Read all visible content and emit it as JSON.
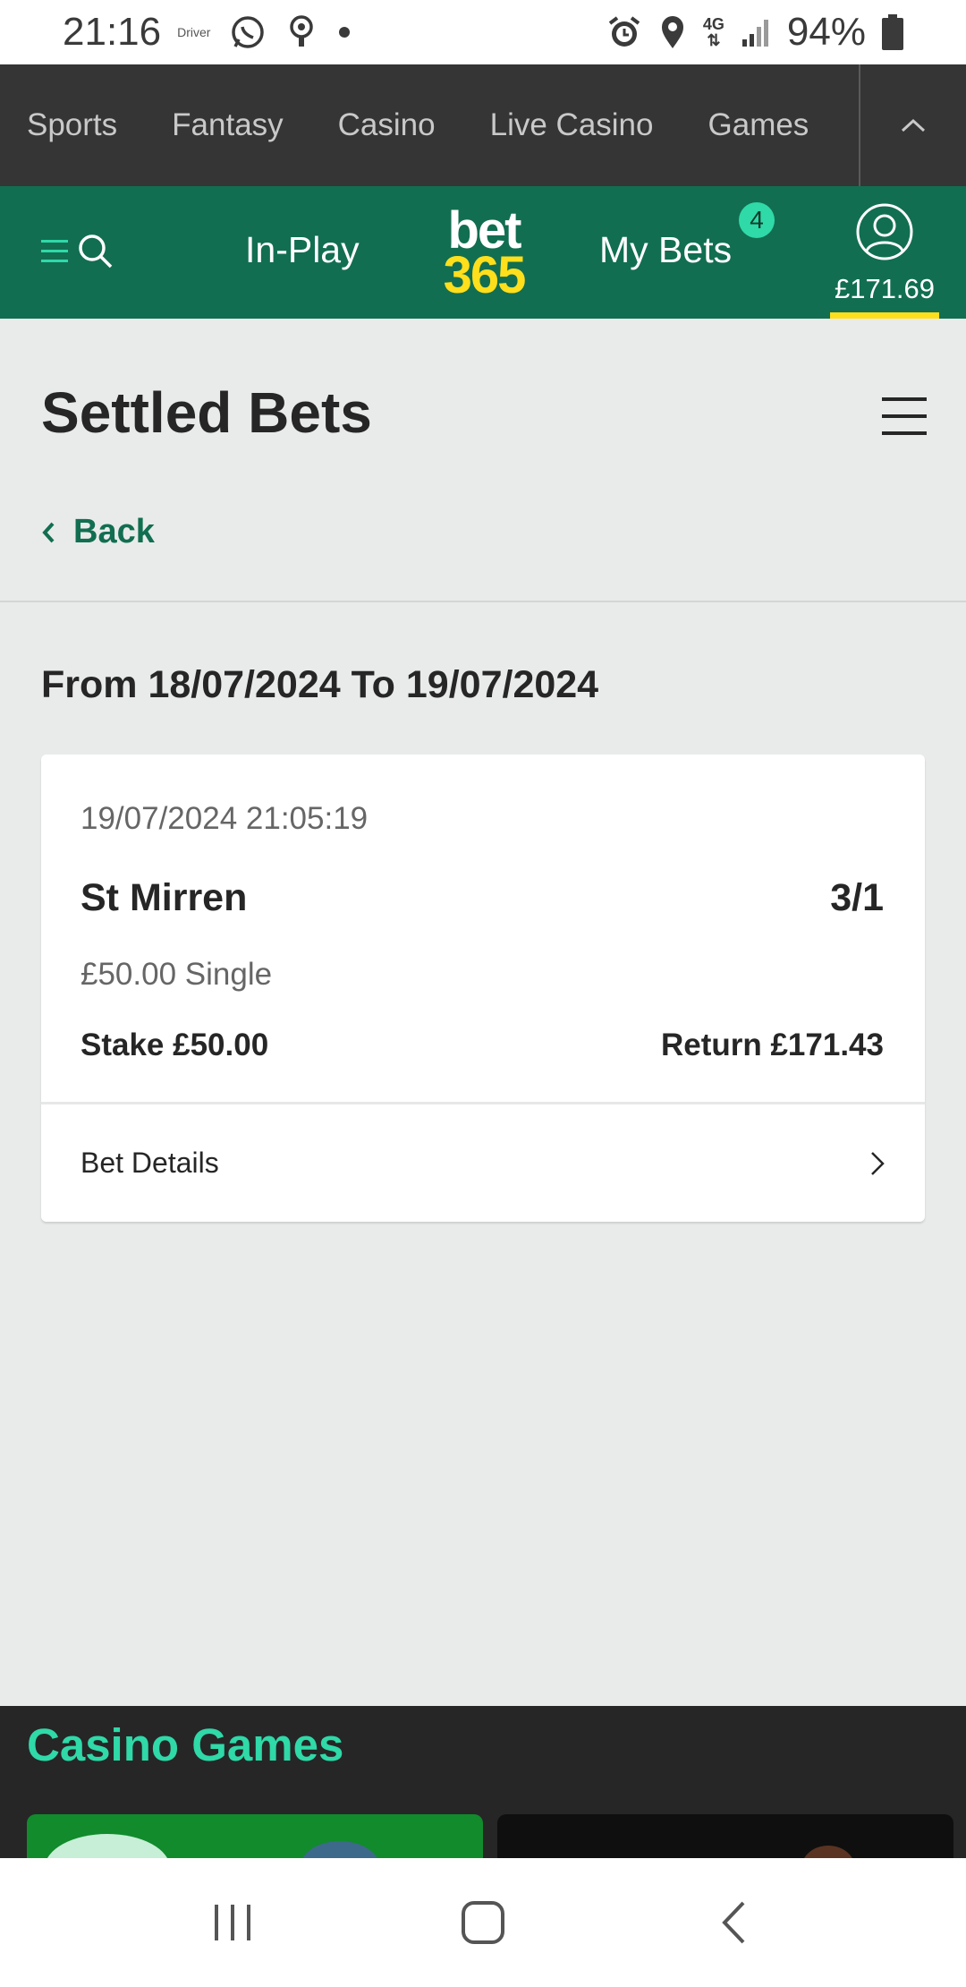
{
  "status_bar": {
    "time": "21:16",
    "driver_label": "Driver",
    "battery_text": "94%",
    "network": "4G",
    "icons": [
      "whatsapp-icon",
      "location-pin-icon",
      "dot-icon",
      "alarm-icon",
      "location-icon",
      "network-4g-icon",
      "signal-icon",
      "battery-icon"
    ]
  },
  "top_nav": {
    "items": [
      {
        "label": "Sports"
      },
      {
        "label": "Fantasy"
      },
      {
        "label": "Casino"
      },
      {
        "label": "Live Casino"
      },
      {
        "label": "Games"
      }
    ]
  },
  "header": {
    "in_play_label": "In-Play",
    "logo_top": "bet",
    "logo_bottom": "365",
    "my_bets_label": "My Bets",
    "my_bets_badge": "4",
    "balance": "£171.69",
    "colors": {
      "header_bg": "#126e51",
      "logo_yellow": "#ffdf1b",
      "badge": "#2fd9a8"
    }
  },
  "page": {
    "title": "Settled Bets",
    "back_label": "Back",
    "date_range": "From 18/07/2024 To 19/07/2024"
  },
  "bet": {
    "datetime": "19/07/2024 21:05:19",
    "selection": "St Mirren",
    "odds": "3/1",
    "bet_type": "£50.00 Single",
    "stake": "Stake £50.00",
    "return": "Return £171.43",
    "details_label": "Bet Details"
  },
  "casino": {
    "title": "Casino Games",
    "accent": "#2fd9a8"
  }
}
